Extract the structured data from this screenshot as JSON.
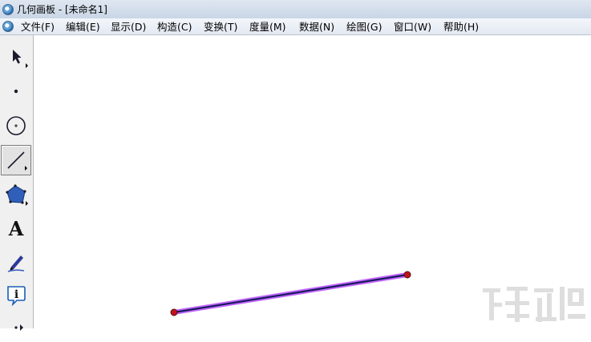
{
  "window": {
    "title": "几何画板 - [未命名1]"
  },
  "menu": [
    {
      "label": "文件(F)"
    },
    {
      "label": "编辑(E)"
    },
    {
      "label": "显示(D)"
    },
    {
      "label": "构造(C)"
    },
    {
      "label": "变换(T)"
    },
    {
      "label": "度量(M)"
    },
    {
      "label": "数据(N)"
    },
    {
      "label": "绘图(G)"
    },
    {
      "label": "窗口(W)"
    },
    {
      "label": "帮助(H)"
    }
  ],
  "toolbox": {
    "tools": [
      {
        "name": "arrow-tool",
        "icon": "arrow-icon",
        "selected": false
      },
      {
        "name": "point-tool",
        "icon": "point-icon",
        "selected": false
      },
      {
        "name": "compass-tool",
        "icon": "circle-icon",
        "selected": false
      },
      {
        "name": "straightedge-tool",
        "icon": "segment-icon",
        "selected": true
      },
      {
        "name": "polygon-tool",
        "icon": "polygon-icon",
        "selected": false
      },
      {
        "name": "text-tool",
        "icon": "text-icon",
        "label": "A",
        "selected": false
      },
      {
        "name": "marker-tool",
        "icon": "marker-pen-icon",
        "selected": false
      },
      {
        "name": "information-tool",
        "icon": "info-icon",
        "label": "i",
        "selected": false
      },
      {
        "name": "custom-tool",
        "icon": "custom-tools-icon",
        "selected": false
      }
    ]
  },
  "canvas": {
    "segment": {
      "line_color": "#1a1a5e",
      "highlight_color": "#c266ff",
      "endpoint_color": "#c0141c"
    }
  },
  "colors": {
    "titlebar": "#c9d6e6",
    "menubar": "#e3e9f2",
    "toolbox": "#f0f0f0"
  }
}
